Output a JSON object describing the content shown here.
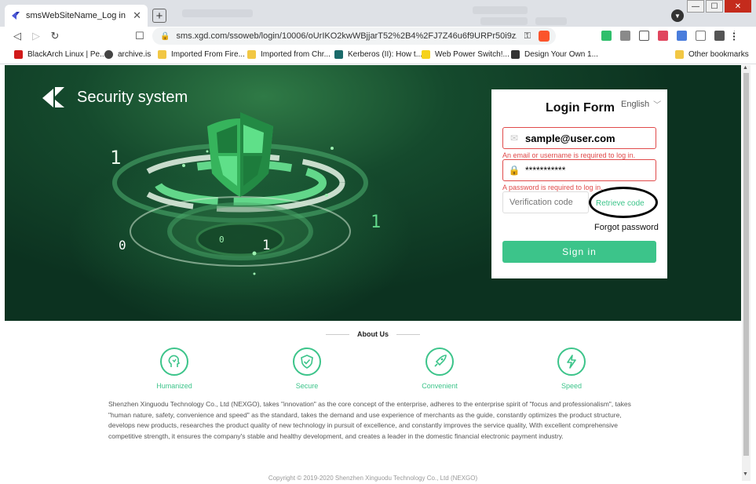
{
  "browser": {
    "tab_title": "smsWebSiteName_Log in",
    "tab_close": "✕",
    "new_tab": "+",
    "url": "sms.xgd.com/ssoweb/login/10006/oUrIKO2kwWBjjarT52%2B4%2FJ7Z46u6f9URPr50i9zZN...",
    "bookmarks": [
      {
        "label": "BlackArch Linux | Pe...",
        "color": "#d11a1a"
      },
      {
        "label": "archive.is",
        "color": "#444444"
      },
      {
        "label": "Imported From Fire...",
        "color": "#f2c744"
      },
      {
        "label": "Imported from Chr...",
        "color": "#f2c744"
      },
      {
        "label": "Kerberos (II): How t...",
        "color": "#1a6a6a"
      },
      {
        "label": "Web Power Switch!...",
        "color": "#f6d21b"
      },
      {
        "label": "Design Your Own 1...",
        "color": "#333333"
      }
    ],
    "bookmarks_overflow": "»",
    "other_bookmarks": "Other bookmarks"
  },
  "page": {
    "brand": "Security system",
    "hero_digits": [
      "1",
      "1",
      "0",
      "0",
      "1"
    ],
    "login": {
      "title": "Login Form",
      "language": "English",
      "email_value": "sample@user.com",
      "email_error": "An email or username is required to log in.",
      "password_value": "***********",
      "password_error": "A password is required to log in.",
      "code_placeholder": "Verification code",
      "retrieve_code": "Retrieve code",
      "forgot_password": "Forgot password",
      "sign_in": "Sign in"
    },
    "about": {
      "title": "About Us",
      "features": [
        {
          "label": "Humanized",
          "icon": "head-icon"
        },
        {
          "label": "Secure",
          "icon": "shield-check-icon"
        },
        {
          "label": "Convenient",
          "icon": "rocket-icon"
        },
        {
          "label": "Speed",
          "icon": "lightning-icon"
        }
      ],
      "text": "Shenzhen Xinguodu Technology Co., Ltd (NEXGO), takes \"innovation\" as the core concept of the enterprise, adheres to the enterprise spirit of \"focus and professionalism\", takes \"human nature, safety, convenience and speed\" as the standard, takes the demand and use experience of merchants as the guide, constantly optimizes the product structure, develops new products, researches the product quality of new technology in pursuit of excellence, and constantly improves the service quality, With excellent comprehensive competitive strength, it ensures the company's stable and healthy development, and creates a leader in the domestic financial electronic payment industry.",
      "copyright": "Copyright © 2019-2020 Shenzhen Xinguodu Technology Co., Ltd (NEXGO)"
    }
  },
  "colors": {
    "accent": "#3cc48a",
    "error": "#e04a4a",
    "hero_dark": "#0c3220"
  }
}
